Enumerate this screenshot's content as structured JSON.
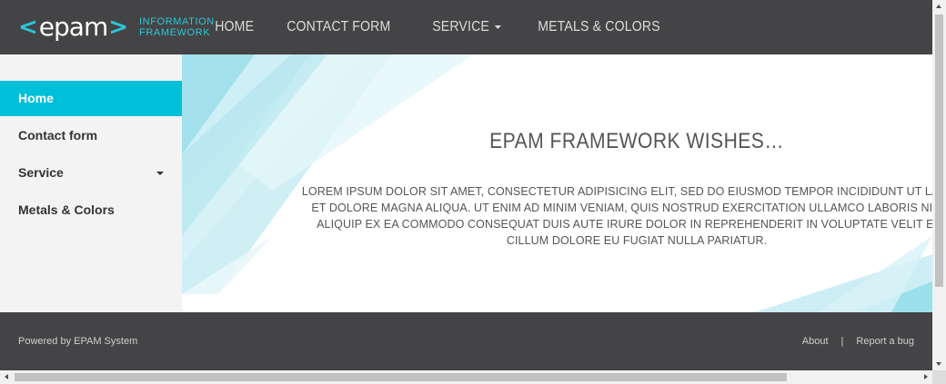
{
  "header": {
    "logo": {
      "word": "epam",
      "subtitle_line1": "INFORMATION",
      "subtitle_line2": "FRAMEWORK"
    },
    "nav": [
      {
        "label": "HOME"
      },
      {
        "label": "CONTACT FORM"
      },
      {
        "label": "SERVICE",
        "has_dropdown": true
      },
      {
        "label": "METALS & COLORS"
      }
    ]
  },
  "sidebar": {
    "items": [
      {
        "label": "Home",
        "active": true
      },
      {
        "label": "Contact form"
      },
      {
        "label": "Service",
        "has_dropdown": true
      },
      {
        "label": "Metals & Colors"
      }
    ]
  },
  "main": {
    "title": "EPAM FRAMEWORK WISHES…",
    "text": "LOREM IPSUM DOLOR SIT AMET, CONSECTETUR ADIPISICING ELIT, SED DO EIUSMOD TEMPOR INCIDIDUNT UT LABORE ET DOLORE MAGNA ALIQUA. UT ENIM AD MINIM VENIAM, QUIS NOSTRUD EXERCITATION ULLAMCO LABORIS NISI UT ALIQUIP EX EA COMMODO CONSEQUAT DUIS AUTE IRURE DOLOR IN REPREHENDERIT IN VOLUPTATE VELIT ESSE CILLUM DOLORE EU FUGIAT NULLA PARIATUR."
  },
  "footer": {
    "powered": "Powered by EPAM System",
    "links": [
      {
        "label": "About"
      },
      {
        "label": "Report a bug"
      }
    ],
    "separator": "|"
  },
  "colors": {
    "header_bg": "#444446",
    "accent": "#00c0d9",
    "sidebar_bg": "#f3f3f3",
    "text_dark": "#333333"
  },
  "icons": {
    "dropdown": "caret-down-icon"
  }
}
